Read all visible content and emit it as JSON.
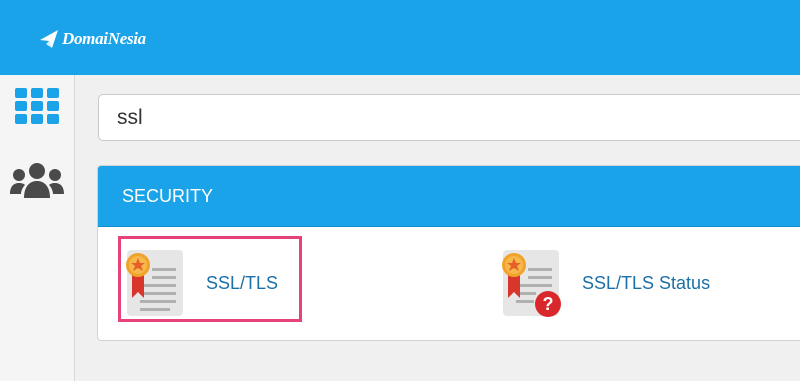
{
  "brand": {
    "logo_text": "DomaiNesia"
  },
  "sidebar": {
    "items": [
      {
        "icon": "grid-icon"
      },
      {
        "icon": "users-icon"
      }
    ]
  },
  "search": {
    "value": "ssl"
  },
  "results": {
    "section_title": "SECURITY",
    "items": [
      {
        "label": "SSL/TLS",
        "icon": "certificate-icon"
      },
      {
        "label": "SSL/TLS Status",
        "icon": "certificate-question-icon"
      }
    ]
  },
  "colors": {
    "header": "#1aa3e8",
    "link": "#1c6fa8",
    "highlight": "#e8427a",
    "icon_gray": "#4a4a4a"
  }
}
